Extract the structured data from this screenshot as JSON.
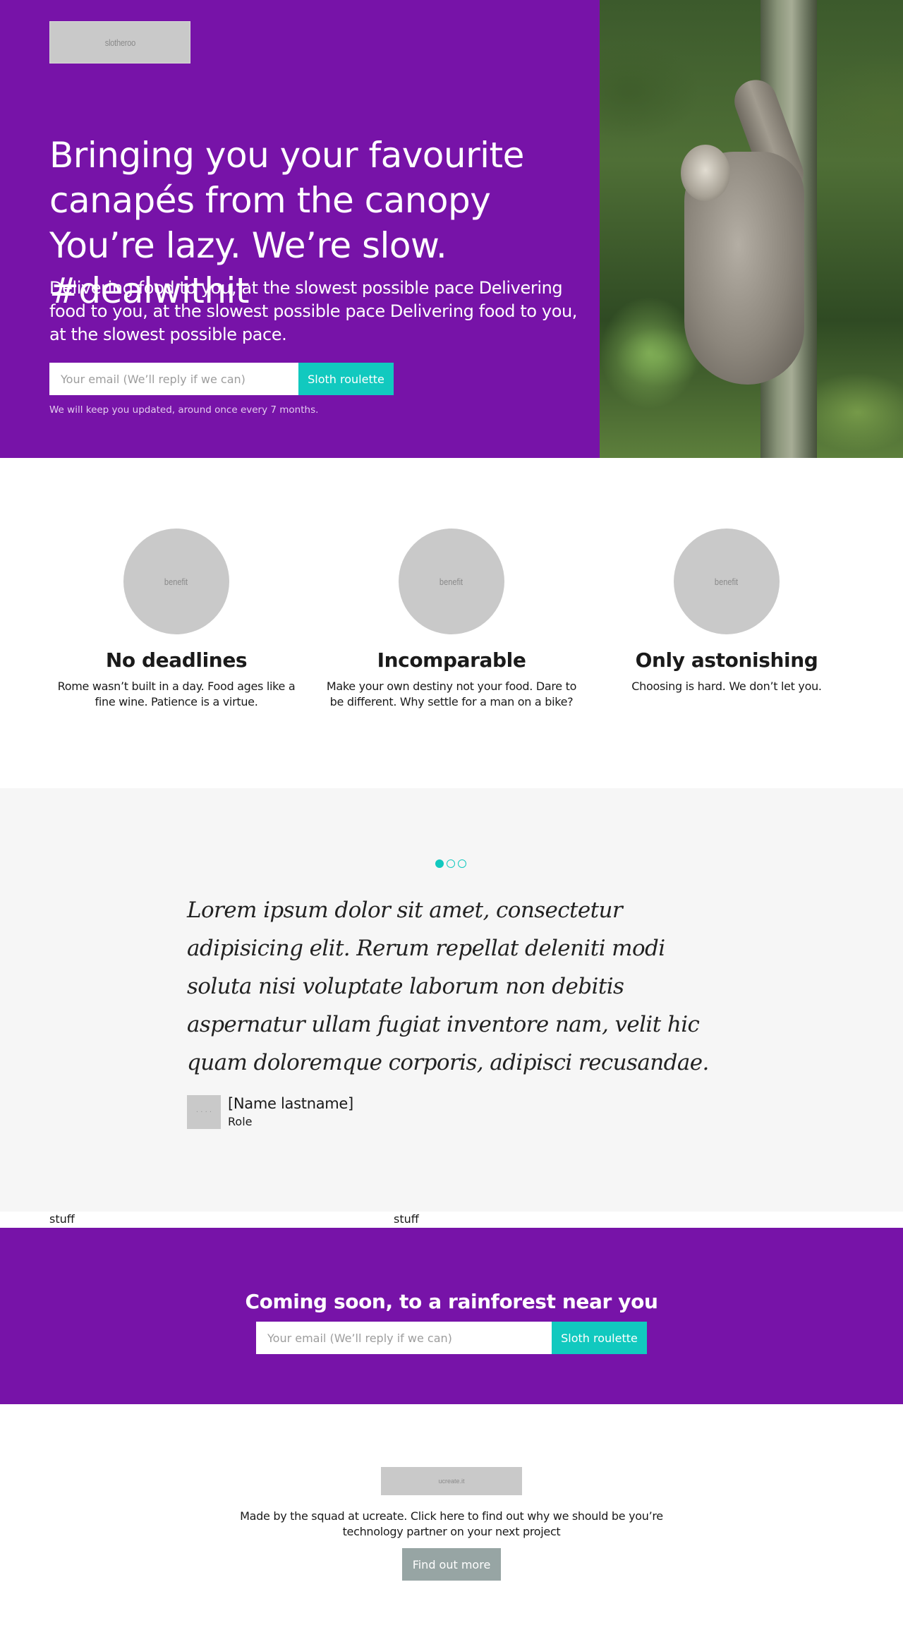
{
  "hero": {
    "logo_text": "slotheroo",
    "title": "Bringing you your favourite canapés from the canopy You’re lazy. We’re slow. #dealwithit",
    "subtitle": "Delivering food to you, at the slowest possible pace Delivering food to you, at the slowest possible pace Delivering food to you, at the slowest possible pace.",
    "email_placeholder": "Your email (We’ll reply if we can)",
    "button_label": "Sloth roulette",
    "note": "We will keep you updated, around once every 7 months."
  },
  "benefits": [
    {
      "image_text": "benefit",
      "title": "No deadlines",
      "text": "Rome wasn’t built in a day. Food ages like a fine wine. Patience is a virtue."
    },
    {
      "image_text": "benefit",
      "title": "Incomparable",
      "text": "Make your own destiny not your food. Dare to be different. Why settle for a man on a bike?"
    },
    {
      "image_text": "benefit",
      "title": "Only astonishing",
      "text": "Choosing is hard. We don’t let you."
    }
  ],
  "testimonial": {
    "quote": "Lorem ipsum dolor sit amet, consectetur adipisicing elit. Rerum repellat deleniti modi soluta nisi voluptate laborum non debitis aspernatur ullam fugiat inventore nam, velit hic quam doloremque corporis, adipisci recusandae.",
    "author_name": "[Name lastname]",
    "author_role": "Role",
    "avatar_text": "· · · ·",
    "active_slide": 1,
    "slide_count": 3
  },
  "stuff": [
    "stuff",
    "stuff"
  ],
  "cta": {
    "title": "Coming soon, to a rainforest near you",
    "email_placeholder": "Your email (We’ll reply if we can)",
    "button_label": "Sloth roulette"
  },
  "footer": {
    "logo_text": "ucreate.it",
    "text": "Made by the squad at ucreate. Click here to find out why we should be you’re technology partner on your next project",
    "button_label": "Find out more"
  },
  "colors": {
    "brand_purple": "#7713a8",
    "accent_teal": "#11c9bf",
    "footer_button": "#97a5a4",
    "placeholder_grey": "#c9c9c9"
  }
}
